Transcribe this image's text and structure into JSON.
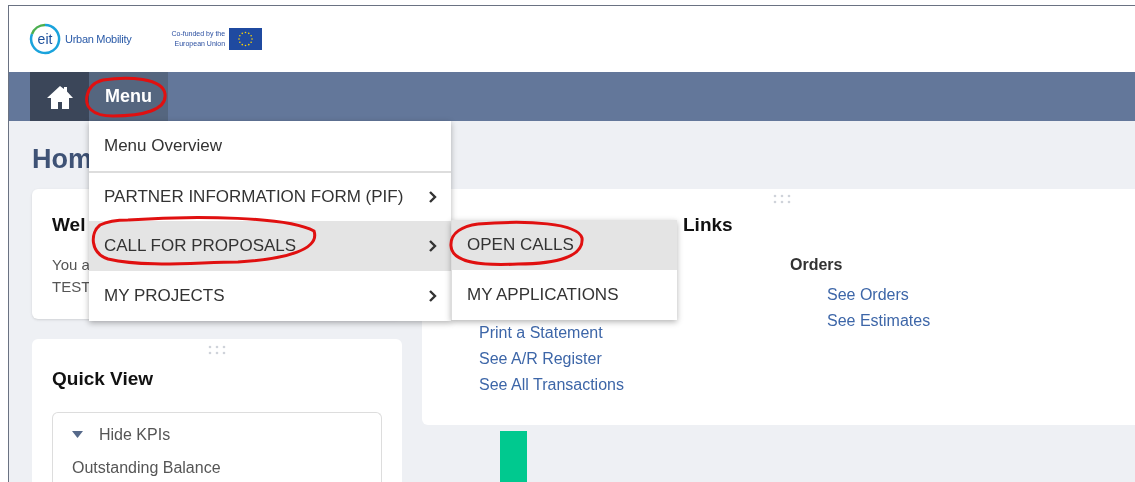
{
  "header": {
    "logo_badge": "eit",
    "logo_text": "Urban Mobility",
    "cofunded_lines": [
      "Co-funded by the",
      "European Union"
    ]
  },
  "nav": {
    "menu_label": "Menu",
    "menu_open": true
  },
  "dropdown": {
    "items": [
      {
        "label": "Menu Overview",
        "has_children": false,
        "selected": false
      },
      {
        "label": "PARTNER INFORMATION FORM (PIF)",
        "has_children": true,
        "selected": false
      },
      {
        "label": "CALL FOR PROPOSALS",
        "has_children": true,
        "selected": true
      },
      {
        "label": "MY PROJECTS",
        "has_children": true,
        "selected": false
      }
    ],
    "submenu": [
      {
        "label": "OPEN CALLS",
        "selected": true
      },
      {
        "label": "MY APPLICATIONS",
        "selected": false
      }
    ]
  },
  "page_title": "Hom",
  "welcome_card": {
    "title": "Wel",
    "lines": [
      "You a",
      "TEST"
    ]
  },
  "quick_view": {
    "title": "Quick View",
    "kpi_toggle": "Hide KPIs",
    "expanded": true,
    "rows": [
      "Outstanding Balance"
    ]
  },
  "links_card": {
    "title": "Links",
    "columns": [
      {
        "links": [
          "Print a Statement",
          "See A/R Register",
          "See All Transactions"
        ]
      },
      {
        "heading": "Orders",
        "links": [
          "See Orders",
          "See Estimates"
        ]
      }
    ]
  }
}
